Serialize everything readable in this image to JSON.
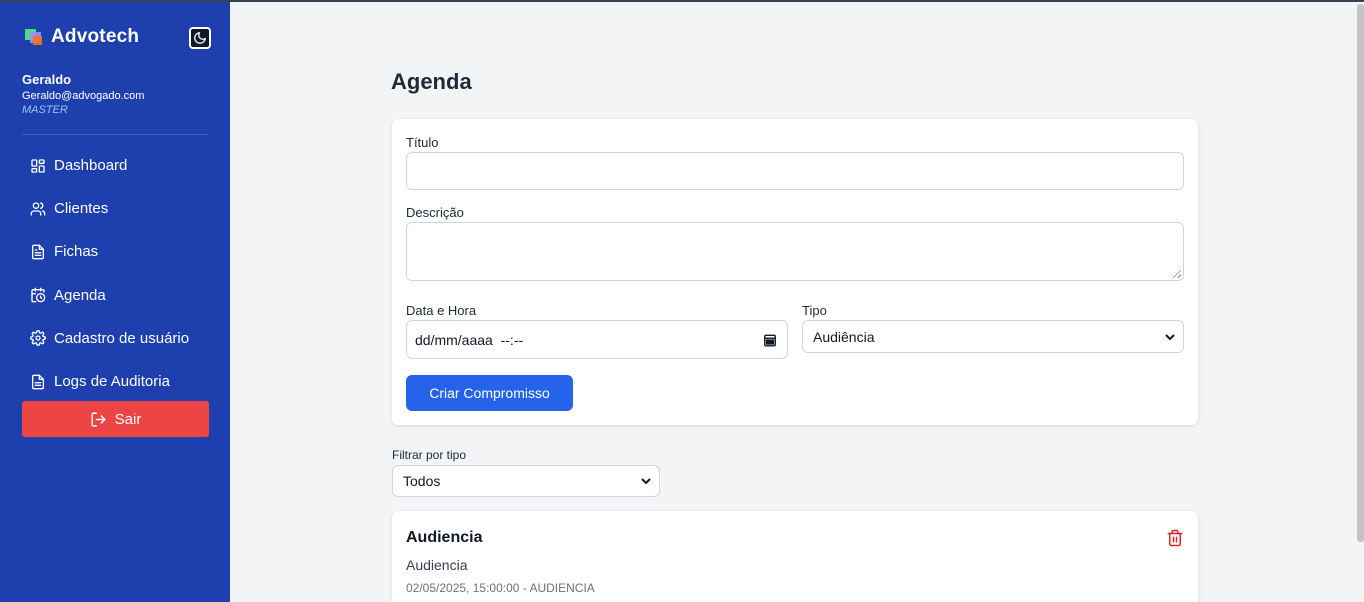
{
  "brand": {
    "name": "Advotech"
  },
  "user": {
    "name": "Geraldo",
    "email": "Geraldo@advogado.com",
    "role": "MASTER"
  },
  "nav": {
    "items": [
      {
        "label": "Dashboard",
        "icon": "dashboard-icon"
      },
      {
        "label": "Clientes",
        "icon": "users-icon"
      },
      {
        "label": "Fichas",
        "icon": "file-icon"
      },
      {
        "label": "Agenda",
        "icon": "calendar-clock-icon"
      },
      {
        "label": "Cadastro de usuário",
        "icon": "gear-icon"
      },
      {
        "label": "Logs de Auditoria",
        "icon": "file-text-icon"
      }
    ],
    "logout_label": "Sair"
  },
  "page": {
    "title": "Agenda"
  },
  "form": {
    "title_label": "Título",
    "title_value": "",
    "description_label": "Descrição",
    "description_value": "",
    "datetime_label": "Data e Hora",
    "datetime_placeholder": "dd/mm/aaaa  --:--",
    "type_label": "Tipo",
    "type_value": "Audiência",
    "submit_label": "Criar Compromisso"
  },
  "filter": {
    "label": "Filtrar por tipo",
    "value": "Todos"
  },
  "events": [
    {
      "title": "Audiencia",
      "description": "Audiencia",
      "meta": "02/05/2025, 15:00:00 - AUDIENCIA"
    }
  ],
  "colors": {
    "sidebar": "#1e40af",
    "logout": "#ef4444",
    "primary": "#2563eb",
    "danger": "#dc2626",
    "background": "#f3f4f6"
  }
}
